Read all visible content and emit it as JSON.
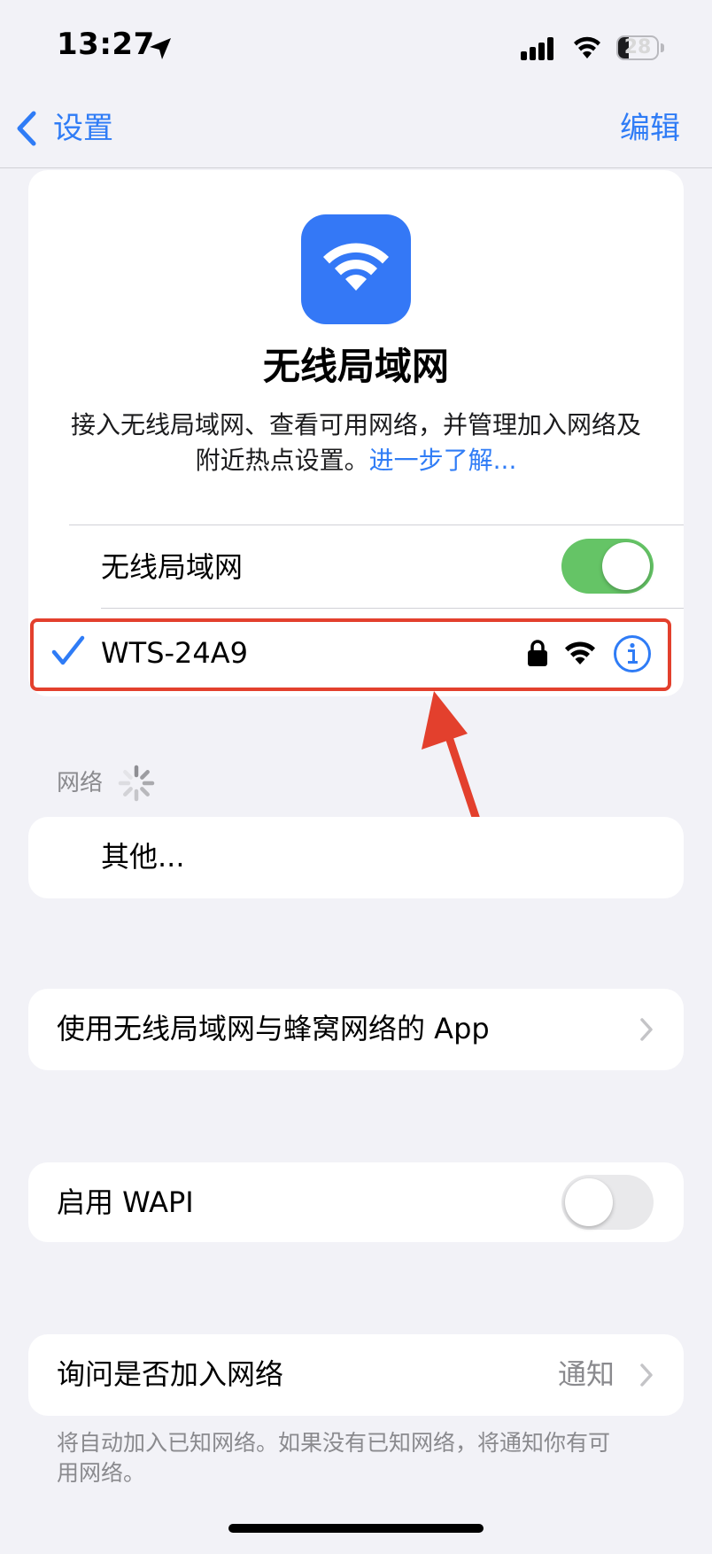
{
  "status_bar": {
    "time": "13:27",
    "battery": "28"
  },
  "nav": {
    "back_label": "设置",
    "edit_label": "编辑"
  },
  "header": {
    "title": "无线局域网",
    "description": "接入无线局域网、查看可用网络，并管理加入网络及附近热点设置。",
    "link": "进一步了解..."
  },
  "wifi_toggle": {
    "label": "无线局域网",
    "state": "on"
  },
  "connected_network": {
    "name": "WTS-24A9",
    "secured": true
  },
  "networks_section": {
    "label": "网络",
    "other_label": "其他..."
  },
  "apps_row": {
    "label": "使用无线局域网与蜂窝网络的 App"
  },
  "wapi_row": {
    "label": "启用 WAPI",
    "state": "off"
  },
  "ask_join": {
    "label": "询问是否加入网络",
    "value": "通知",
    "footnote": "将自动加入已知网络。如果没有已知网络，将通知你有可用网络。"
  },
  "colors": {
    "accent": "#2f7cf6",
    "toggle_on": "#65c466",
    "annotation": "#e3402d",
    "background": "#f2f2f7"
  },
  "icons": [
    "location-arrow-icon",
    "cellular-signal-icon",
    "wifi-icon",
    "battery-icon",
    "chevron-left-icon",
    "checkmark-icon",
    "lock-icon",
    "info-icon",
    "loading-spinner-icon",
    "chevron-right-icon"
  ]
}
